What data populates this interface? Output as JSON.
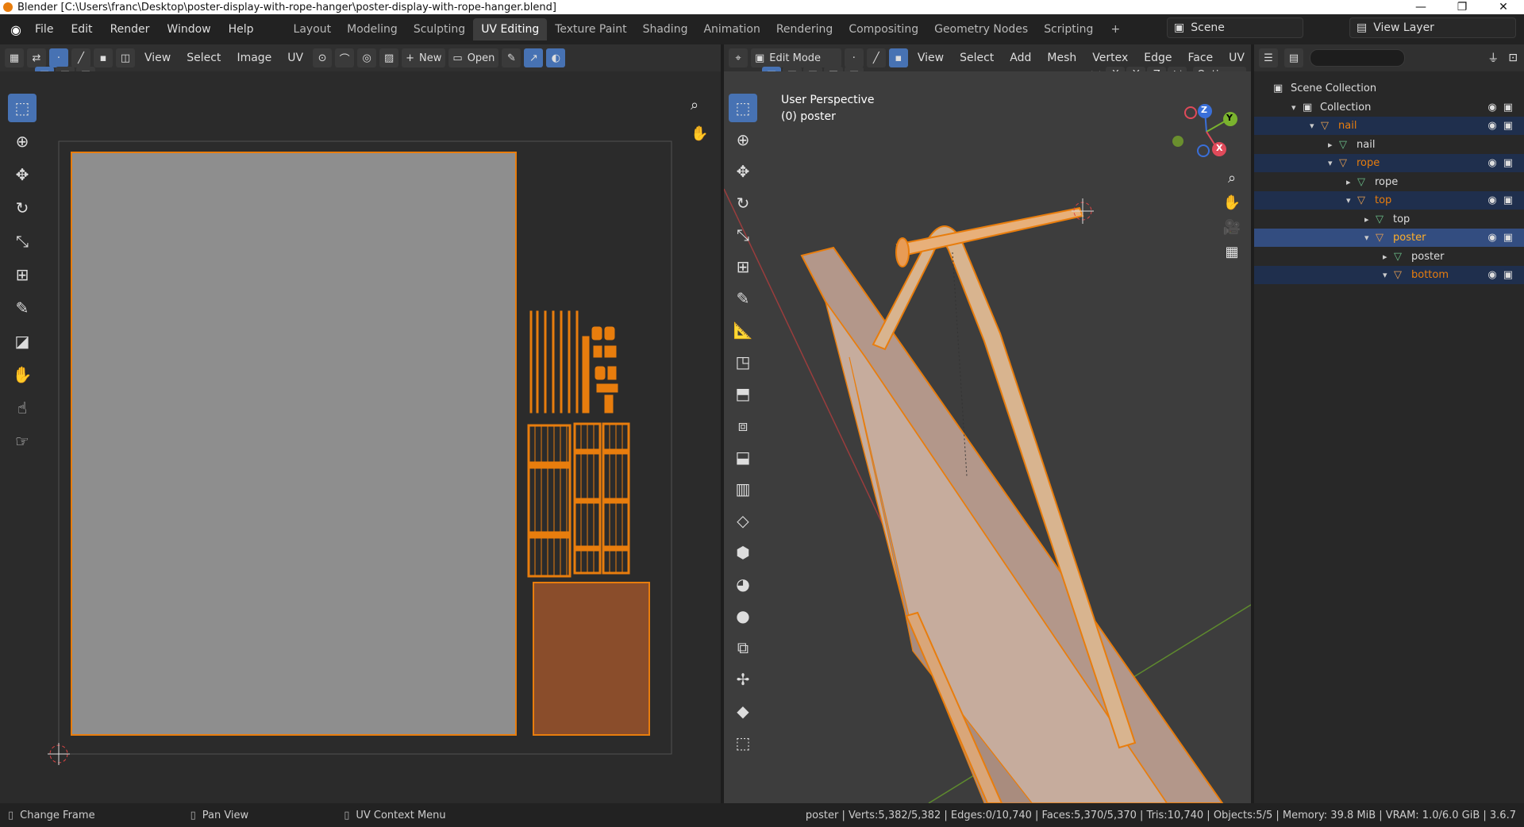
{
  "titlebar": {
    "title": "Blender [C:\\Users\\franc\\Desktop\\poster-display-with-rope-hanger\\poster-display-with-rope-hanger.blend]",
    "minimize": "—",
    "restore": "❐",
    "close": "✕"
  },
  "menus": [
    "File",
    "Edit",
    "Render",
    "Window",
    "Help"
  ],
  "workspaces": [
    {
      "label": "Layout",
      "active": false
    },
    {
      "label": "Modeling",
      "active": false
    },
    {
      "label": "Sculpting",
      "active": false
    },
    {
      "label": "UV Editing",
      "active": true
    },
    {
      "label": "Texture Paint",
      "active": false
    },
    {
      "label": "Shading",
      "active": false
    },
    {
      "label": "Animation",
      "active": false
    },
    {
      "label": "Rendering",
      "active": false
    },
    {
      "label": "Compositing",
      "active": false
    },
    {
      "label": "Geometry Nodes",
      "active": false
    },
    {
      "label": "Scripting",
      "active": false
    }
  ],
  "add_workspace": "+",
  "scene": {
    "label": "Scene",
    "view_layer": "View Layer"
  },
  "uv_editor": {
    "menus": [
      "View",
      "Select",
      "Image",
      "UV"
    ],
    "new_label": "New",
    "open_label": "Open",
    "colors": {
      "bg": "#2b2b2b",
      "image": "#8e8e8e",
      "uv": "#e87d0d",
      "face": "#8a4d2b"
    }
  },
  "viewport": {
    "mode": "Edit Mode",
    "menus": [
      "View",
      "Select",
      "Add",
      "Mesh",
      "Vertex",
      "Edge",
      "Face",
      "UV"
    ],
    "axes": [
      "X",
      "Y",
      "Z"
    ],
    "options_label": "Options",
    "perspective": "User Perspective",
    "object": "(0) poster",
    "gizmo": {
      "x": "X",
      "y": "Y",
      "z": "Z"
    }
  },
  "outliner": {
    "search_placeholder": "",
    "rows": [
      {
        "label": "Scene Collection",
        "indent": 0,
        "kind": "scene",
        "selected": "none",
        "color": "#dddddd"
      },
      {
        "label": "Collection",
        "indent": 1,
        "kind": "collection",
        "selected": "none",
        "color": "#dddddd"
      },
      {
        "label": "nail",
        "indent": 2,
        "kind": "object",
        "selected": "sel2",
        "color": "#e87d0d"
      },
      {
        "label": "nail",
        "indent": 3,
        "kind": "mesh",
        "selected": "none",
        "color": "#dddddd"
      },
      {
        "label": "rope",
        "indent": 3,
        "kind": "object",
        "selected": "sel2",
        "color": "#e87d0d"
      },
      {
        "label": "rope",
        "indent": 4,
        "kind": "mesh",
        "selected": "none",
        "color": "#dddddd"
      },
      {
        "label": "top",
        "indent": 4,
        "kind": "object",
        "selected": "sel2",
        "color": "#e87d0d"
      },
      {
        "label": "top",
        "indent": 5,
        "kind": "mesh",
        "selected": "none",
        "color": "#dddddd"
      },
      {
        "label": "poster",
        "indent": 5,
        "kind": "object",
        "selected": "sel",
        "color": "#ffaf29"
      },
      {
        "label": "poster",
        "indent": 6,
        "kind": "mesh",
        "selected": "none",
        "color": "#dddddd"
      },
      {
        "label": "bottom",
        "indent": 6,
        "kind": "object",
        "selected": "sel2",
        "color": "#e87d0d"
      }
    ]
  },
  "status": {
    "left": [
      {
        "icon": "mouse-left-icon",
        "label": "Change Frame"
      },
      {
        "icon": "mouse-middle-icon",
        "label": "Pan View"
      },
      {
        "icon": "mouse-right-icon",
        "label": "UV Context Menu"
      }
    ],
    "right": "poster | Verts:5,382/5,382 | Edges:0/10,740 | Faces:5,370/5,370 | Tris:10,740 | Objects:5/5 | Memory: 39.8 MiB | VRAM: 1.0/6.0 GiB | 3.6.7"
  }
}
